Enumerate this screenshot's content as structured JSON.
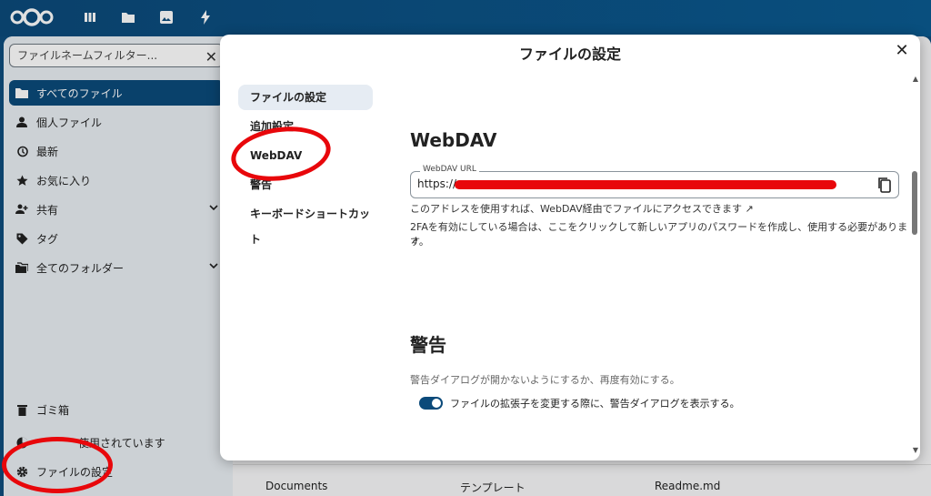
{
  "topbar": {
    "nav_icons": [
      "dashboard-icon",
      "files-icon",
      "photos-icon",
      "activity-icon"
    ]
  },
  "sidebar": {
    "filter_placeholder": "ファイルネームフィルター...",
    "items": [
      {
        "label": "すべてのファイル",
        "icon": "folder-icon",
        "active": true
      },
      {
        "label": "個人ファイル",
        "icon": "user-icon"
      },
      {
        "label": "最新",
        "icon": "history-icon"
      },
      {
        "label": "お気に入り",
        "icon": "star-icon"
      },
      {
        "label": "共有",
        "icon": "share-icon"
      },
      {
        "label": "タグ",
        "icon": "tag-icon"
      },
      {
        "label": "全てのフォルダー",
        "icon": "folders-icon"
      }
    ],
    "trash_label": "ゴミ箱",
    "quota_label": "使用されています",
    "settings_label": "ファイルの設定"
  },
  "background_files": {
    "documents": "Documents",
    "templates": "テンプレート",
    "readme": "Readme.md"
  },
  "modal": {
    "title": "ファイルの設定",
    "nav": [
      {
        "label": "ファイルの設定",
        "active": true
      },
      {
        "label": "追加設定"
      },
      {
        "label": "WebDAV"
      },
      {
        "label": "警告"
      },
      {
        "label": "キーボードショートカット"
      }
    ],
    "webdav": {
      "heading": "WebDAV",
      "url_label": "WebDAV URL",
      "url_value": "https://",
      "hint1": "このアドレスを使用すれば、WebDAV経由でファイルにアクセスできます ↗",
      "hint2": "2FAを有効にしている場合は、ここをクリックして新しいアプリのパスワードを作成し、使用する必要があります。",
      "hint2_arrow": "↗"
    },
    "warning": {
      "heading": "警告",
      "description": "警告ダイアログが開かないようにするか、再度有効にする。",
      "toggle_label": "ファイルの拡張子を変更する際に、警告ダイアログを表示する。",
      "toggle_on": true
    }
  },
  "colors": {
    "primary": "#0b4a7a",
    "annotation_red": "#e8070b"
  }
}
